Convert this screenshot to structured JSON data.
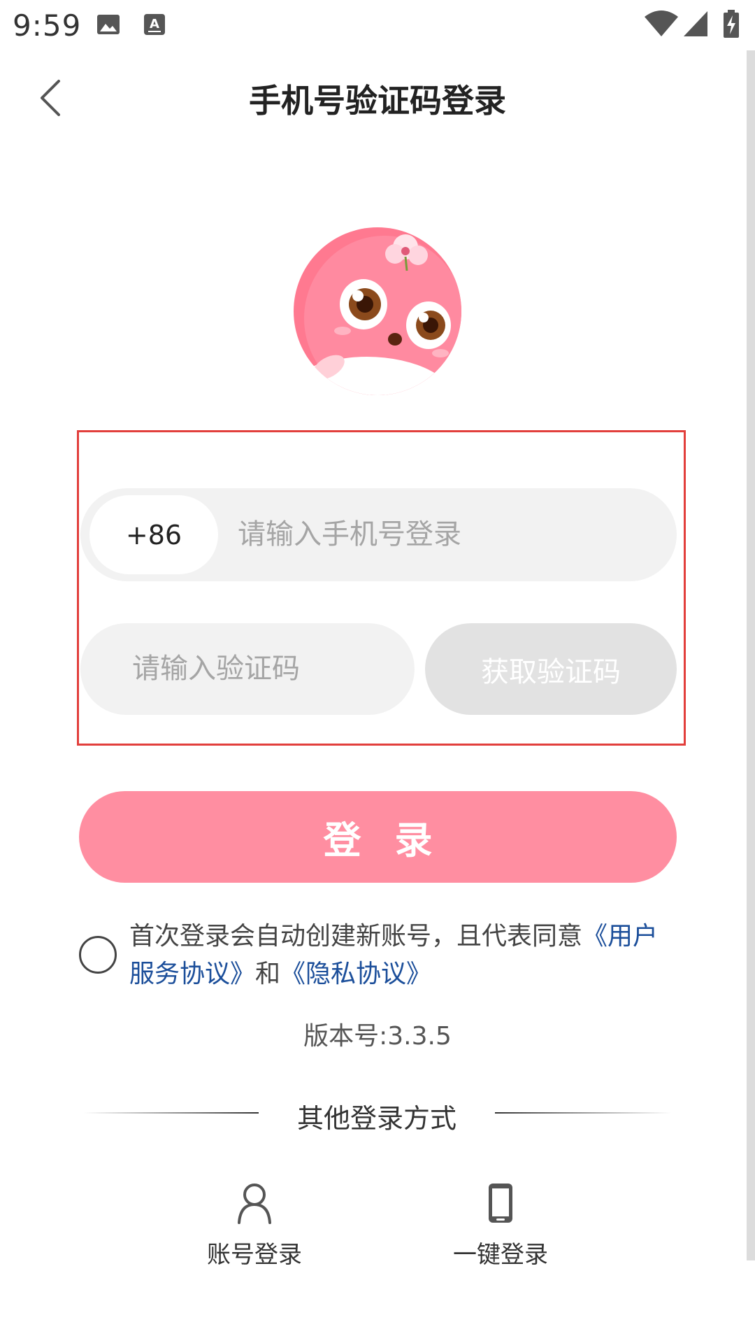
{
  "status_bar": {
    "time": "9:59",
    "icons": [
      "image-icon",
      "keyboard-a-icon",
      "wifi-icon",
      "signal-icon",
      "battery-charging-icon"
    ]
  },
  "header": {
    "title": "手机号验证码登录",
    "back_icon": "chevron-left-icon"
  },
  "form": {
    "country_code": "+86",
    "phone_placeholder": "请输入手机号登录",
    "code_placeholder": "请输入验证码",
    "get_code_label": "获取验证码"
  },
  "login_button": "登录",
  "agreement": {
    "text": "首次登录会自动创建新账号，且代表同意",
    "link_user_agreement": "《用户服务协议》",
    "conjunction": "和",
    "link_privacy": "《隐私协议》"
  },
  "version": "版本号:3.3.5",
  "other_login": {
    "title": "其他登录方式",
    "options": [
      {
        "label": "账号登录",
        "icon": "person-icon"
      },
      {
        "label": "一键登录",
        "icon": "phone-icon"
      }
    ]
  },
  "colors": {
    "accent": "#ff8ea1",
    "link": "#1b4e9a",
    "highlight_border": "#e23f3c"
  }
}
